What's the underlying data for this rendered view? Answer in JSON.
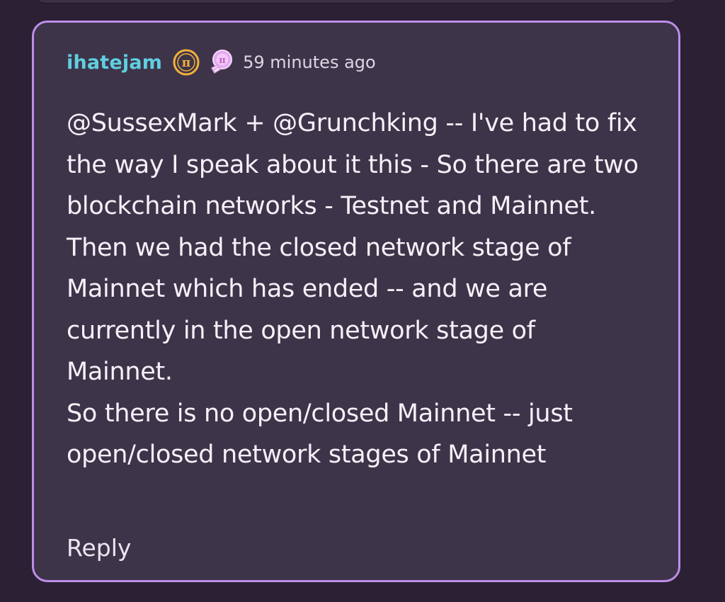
{
  "comment": {
    "username": "ihatejam",
    "badges": [
      "pi-coin-badge-icon",
      "pi-lightbulb-badge-icon"
    ],
    "timestamp": "59 minutes ago",
    "paragraphs": [
      "@SussexMark + @Grunchking -- I've had to fix the way I speak about it this - So there are two blockchain networks - Testnet and Mainnet.",
      "Then we had the closed network stage of Mainnet which has ended -- and we are currently in the open network stage of Mainnet.",
      "So there is no open/closed Mainnet -- just open/closed network stages of Mainnet"
    ],
    "reply_label": "Reply"
  },
  "colors": {
    "card_border": "#bd8ee8",
    "card_bg": "#3e3449",
    "username": "#5fcfe0",
    "page_bg": "#2b2034",
    "badge_gold": "#f2b13a",
    "badge_pink": "#e5a8f0"
  }
}
